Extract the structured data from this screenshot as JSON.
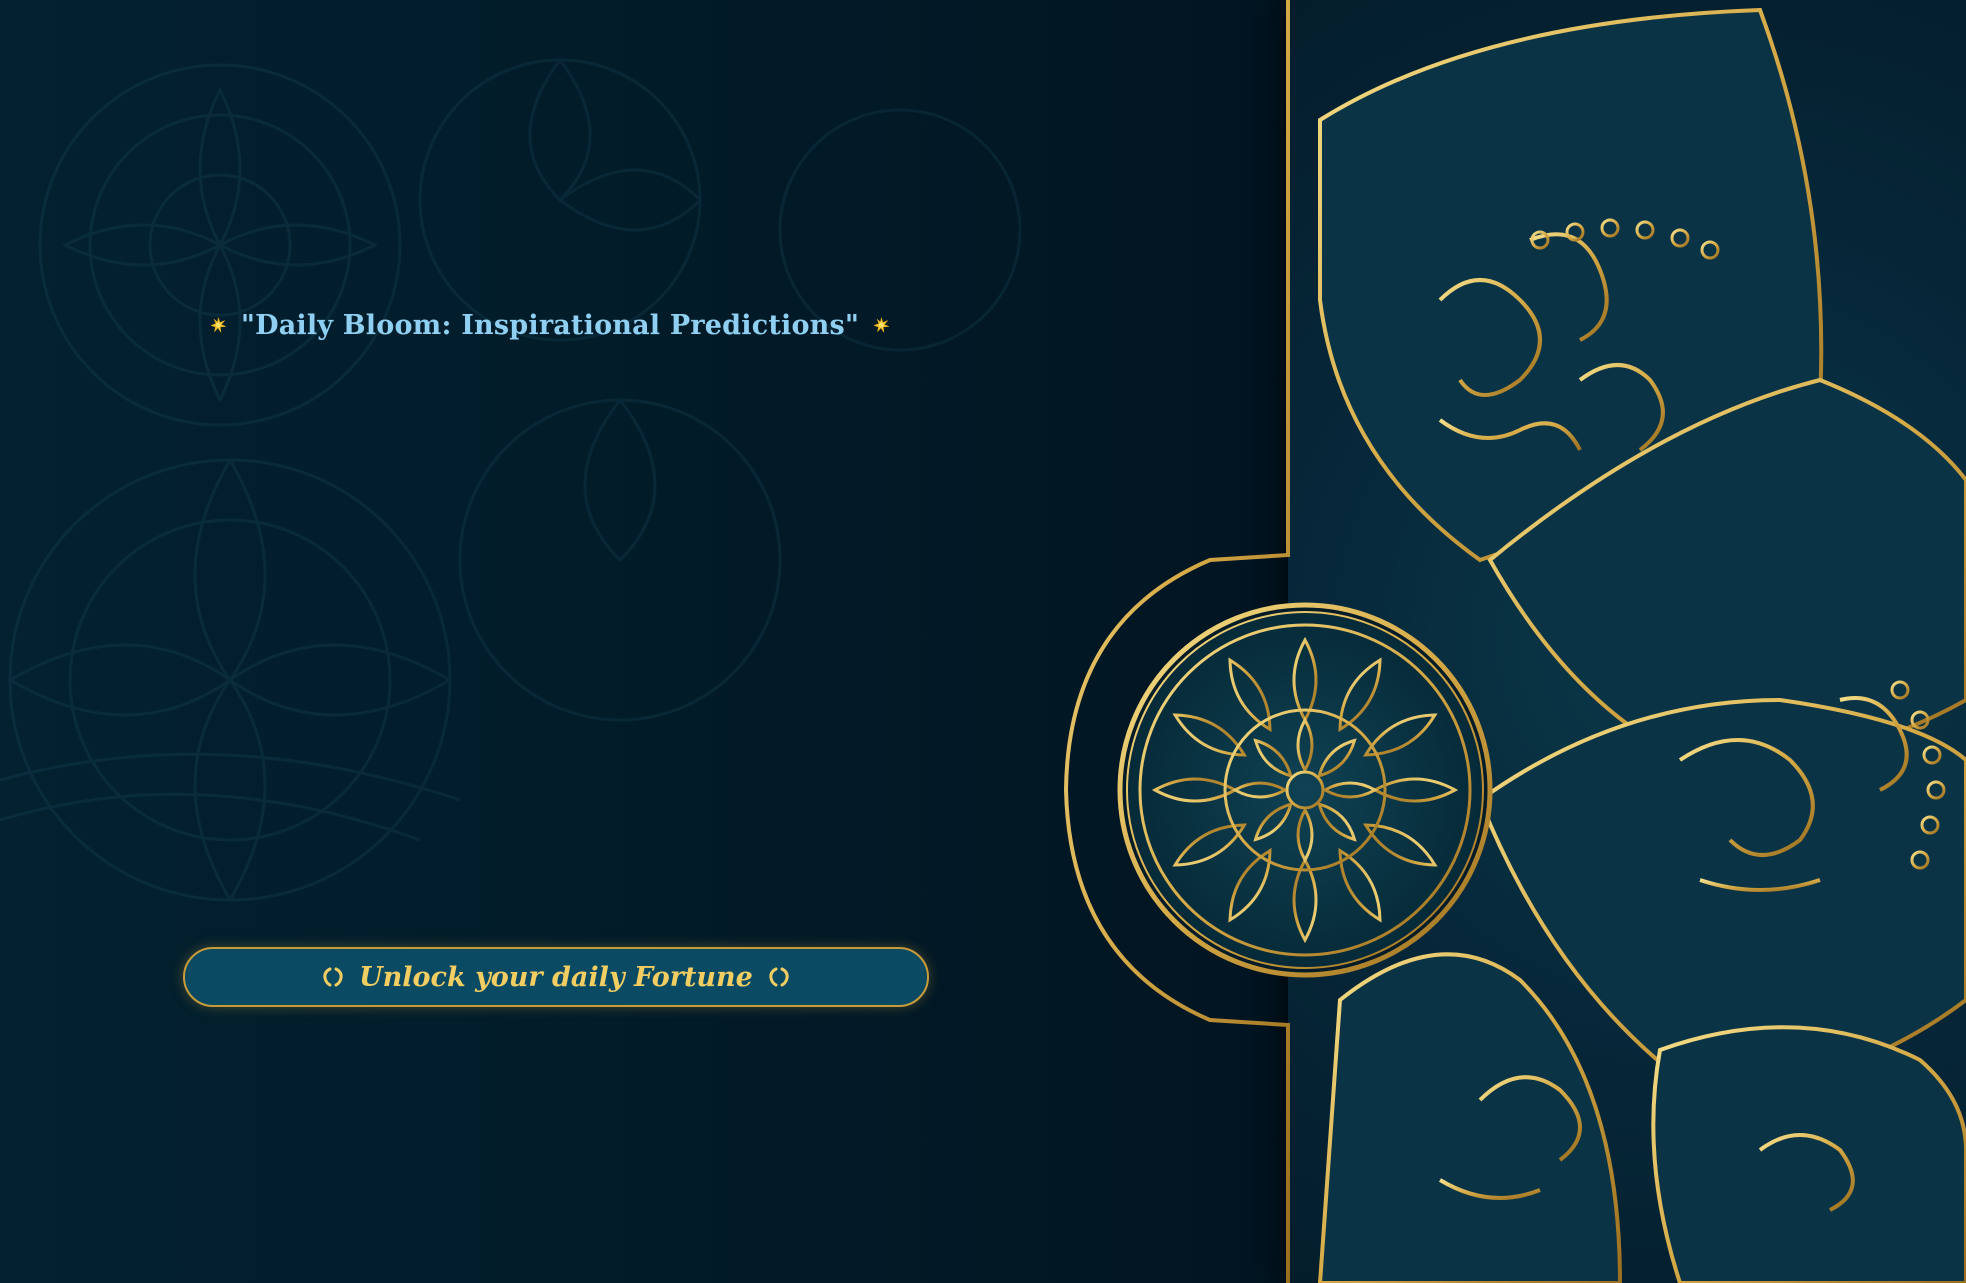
{
  "header": {
    "title": "\"Daily Bloom: Inspirational Predictions\"",
    "left_icon": "sparkle-icon",
    "right_icon": "sparkle-icon"
  },
  "action": {
    "label": "Unlock your daily Fortune",
    "left_icon": "cycle-icon",
    "right_icon": "cycle-icon"
  },
  "colors": {
    "background": "#021a28",
    "title_text": "#8fd0f2",
    "button_fill": "#0a4a62",
    "button_border": "#c79b3a",
    "button_text": "#f1cd62",
    "ornament_gold": "#d9b451"
  }
}
